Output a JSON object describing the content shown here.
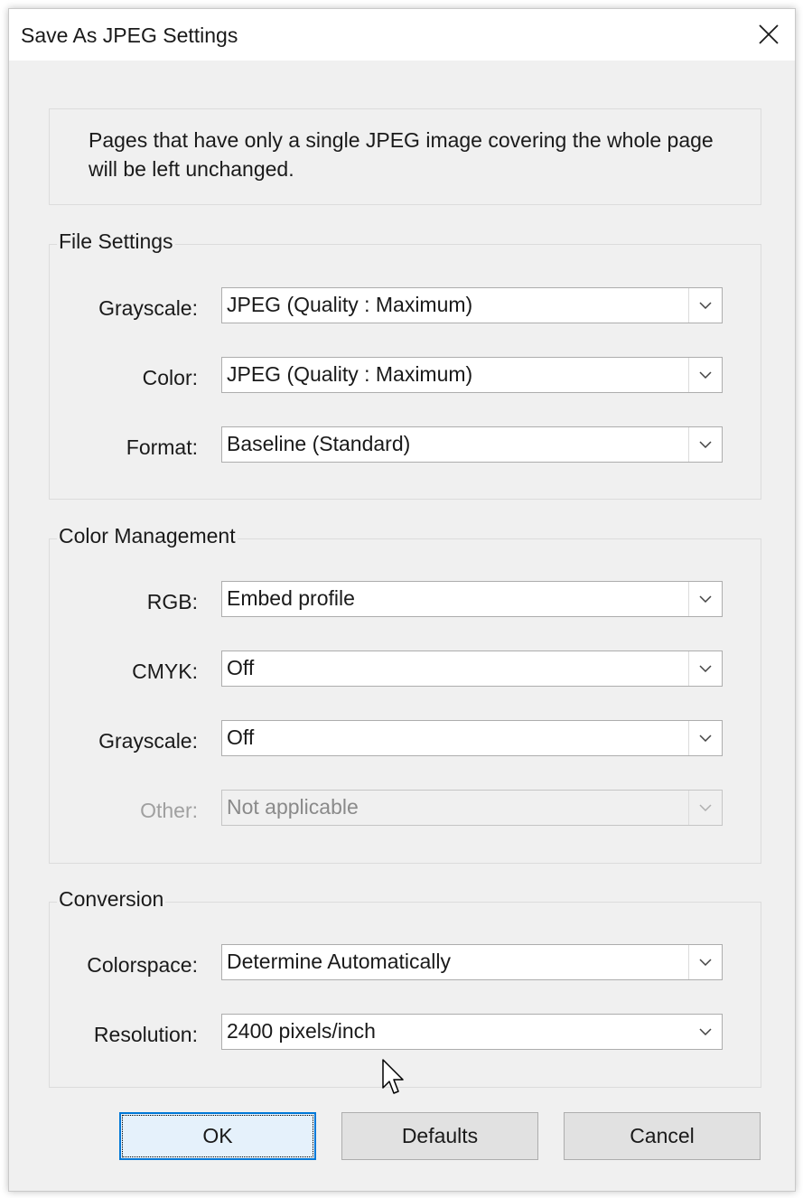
{
  "dialog": {
    "title": "Save As JPEG Settings",
    "close_icon": "close-icon"
  },
  "info": {
    "text": "Pages that have only a single JPEG image covering the whole page will be left unchanged."
  },
  "file_settings": {
    "label": "File Settings",
    "grayscale_label": "Grayscale:",
    "grayscale_value": "JPEG (Quality : Maximum)",
    "color_label": "Color:",
    "color_value": "JPEG (Quality : Maximum)",
    "format_label": "Format:",
    "format_value": "Baseline (Standard)"
  },
  "color_management": {
    "label": "Color Management",
    "rgb_label": "RGB:",
    "rgb_value": "Embed profile",
    "cmyk_label": "CMYK:",
    "cmyk_value": "Off",
    "grayscale_label": "Grayscale:",
    "grayscale_value": "Off",
    "other_label": "Other:",
    "other_value": "Not applicable"
  },
  "conversion": {
    "label": "Conversion",
    "colorspace_label": "Colorspace:",
    "colorspace_value": "Determine Automatically",
    "resolution_label": "Resolution:",
    "resolution_value": "2400 pixels/inch"
  },
  "buttons": {
    "ok": "OK",
    "defaults": "Defaults",
    "cancel": "Cancel"
  },
  "colors": {
    "accent": "#0078d7",
    "dialog_bg": "#f0f0f0",
    "disabled_text": "#a0a0a0"
  }
}
